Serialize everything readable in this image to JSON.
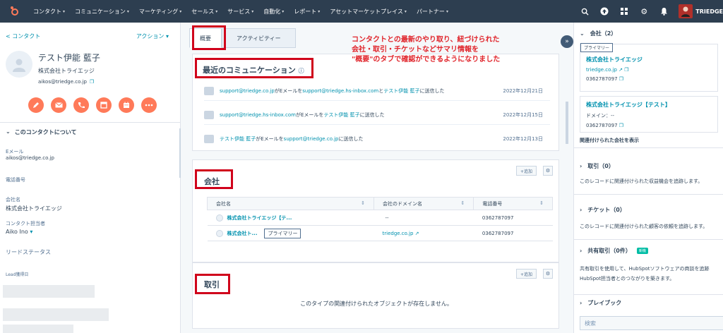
{
  "nav": {
    "items": [
      {
        "label": "コンタクト"
      },
      {
        "label": "コミュニケーション"
      },
      {
        "label": "マーケティング"
      },
      {
        "label": "セールス"
      },
      {
        "label": "サービス"
      },
      {
        "label": "自動化"
      },
      {
        "label": "レポート"
      },
      {
        "label": "アセットマーケットプレイス"
      },
      {
        "label": "パートナー"
      }
    ],
    "account": "TRIEDGE"
  },
  "contact": {
    "back_label": "< コンタクト",
    "actions_label": "アクション ▾",
    "name": "テスト伊能 藍子",
    "company": "株式会社トライエッジ",
    "email": "aikos@triedge.co.jp",
    "about_header": "このコンタクトについて",
    "props": [
      {
        "label": "Eメール",
        "value": "aikos@triedge.co.jp"
      },
      {
        "label": "電話番号",
        "value": ""
      },
      {
        "label": "会社名",
        "value": "株式会社トライエッジ"
      },
      {
        "label": "コンタクト担当者",
        "value": "Aiko Ino"
      },
      {
        "label": "リードステータス",
        "value": ""
      },
      {
        "label": "Lead獲得日",
        "value": ""
      }
    ]
  },
  "tabs": [
    {
      "label": "概要"
    },
    {
      "label": "アクティビティー"
    }
  ],
  "annotation": {
    "line1": "コンタクトとの最新のやり取り、紐づけられた",
    "line2": "会社・取引・チケットなどサマリ情報を",
    "line3": "\"概要\"のタブで確認ができるようになりました"
  },
  "comms": {
    "title": "最近のコミュニケーション",
    "rows": [
      {
        "from": "support@triedge.co.jp",
        "mid1": "がEメールを",
        "to": "support@triedge.hs-inbox.com",
        "mid2": "と",
        "who": "テスト伊能 藍子",
        "tail": "に送信した",
        "date": "2022年12月21日"
      },
      {
        "from": "support@triedge.hs-inbox.com",
        "mid1": "がEメールを",
        "to": "",
        "mid2": "",
        "who": "テスト伊能 藍子",
        "tail": "に送信した",
        "date": "2022年12月15日"
      },
      {
        "from": "テスト伊能 藍子",
        "mid1": "がEメールを",
        "to": "support@triedge.co.jp",
        "mid2": "",
        "who": "",
        "tail": "に送信した",
        "date": "2022年12月13日"
      }
    ]
  },
  "company_card": {
    "title": "会社",
    "add_label": "+追加",
    "columns": [
      "会社名",
      "会社のドメイン名",
      "電話番号"
    ],
    "rows": [
      {
        "name": "株式会社トライエッジ【テ...",
        "domain": "--",
        "phone": "0362787097",
        "primary": ""
      },
      {
        "name": "株式会社ト...",
        "domain": "triedge.co.jp",
        "phone": "0362787097",
        "primary": "プライマリー"
      }
    ]
  },
  "deal_card": {
    "title": "取引",
    "add_label": "+追加",
    "empty": "このタイプの関連付けられたオブジェクトが存在しません。"
  },
  "right": {
    "company_header": "会社（2）",
    "primary_tag": "プライマリー",
    "company1": {
      "name": "株式会社トライエッジ",
      "domain": "triedge.co.jp",
      "phone": "0362787097"
    },
    "company2": {
      "name": "株式会社トライエッジ【テスト】",
      "domain_label": "ドメイン：--",
      "phone": "0362787097"
    },
    "show_link": "関連付けられた会社を表示",
    "deals_header": "取引（0）",
    "deals_text": "このレコードに関連付けられた収益機会を追跡します。",
    "tickets_header": "チケット（0）",
    "tickets_text": "このレコードに関連付けられた顧客の依頼を追跡します。",
    "shared_header": "共有取引（0件）",
    "new_badge": "新機",
    "shared_text1": "共有取引を使用して、HubSpotソフトウェアの商談を追跡",
    "shared_text2": "HubSpot担当者とのつながりを築きます。",
    "playbook_header": "プレイブック",
    "search_placeholder": "検索"
  }
}
